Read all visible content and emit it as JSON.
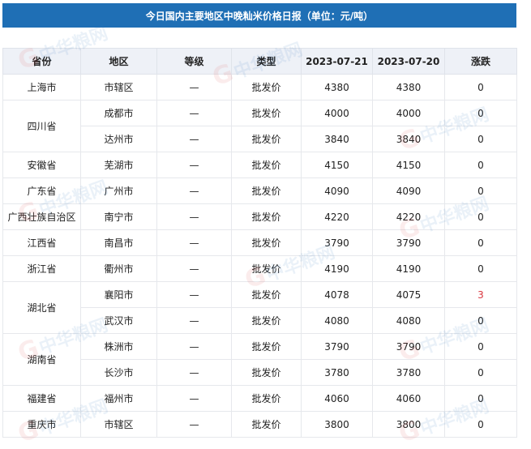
{
  "title": "今日国内主要地区中晚籼米价格日报（单位：元/吨）",
  "headers": [
    "省份",
    "地区",
    "等级",
    "类型",
    "2023-07-21",
    "2023-07-20",
    "涨跌"
  ],
  "grade_dash": "—",
  "type_label": "批发价",
  "watermark": "中华粮网",
  "rows": [
    {
      "province": "上海市",
      "span": 1,
      "city": "市辖区",
      "p1": "4380",
      "p2": "4380",
      "chg": "0"
    },
    {
      "province": "四川省",
      "span": 2,
      "city": "成都市",
      "p1": "4000",
      "p2": "4000",
      "chg": "0"
    },
    {
      "province": "",
      "span": 0,
      "city": "达州市",
      "p1": "3840",
      "p2": "3840",
      "chg": "0"
    },
    {
      "province": "安徽省",
      "span": 1,
      "city": "芜湖市",
      "p1": "4150",
      "p2": "4150",
      "chg": "0"
    },
    {
      "province": "广东省",
      "span": 1,
      "city": "广州市",
      "p1": "4090",
      "p2": "4090",
      "chg": "0"
    },
    {
      "province": "广西壮族自治区",
      "span": 1,
      "city": "南宁市",
      "p1": "4220",
      "p2": "4220",
      "chg": "0"
    },
    {
      "province": "江西省",
      "span": 1,
      "city": "南昌市",
      "p1": "3790",
      "p2": "3790",
      "chg": "0"
    },
    {
      "province": "浙江省",
      "span": 1,
      "city": "衢州市",
      "p1": "4190",
      "p2": "4190",
      "chg": "0"
    },
    {
      "province": "湖北省",
      "span": 2,
      "city": "襄阳市",
      "p1": "4078",
      "p2": "4075",
      "chg": "3"
    },
    {
      "province": "",
      "span": 0,
      "city": "武汉市",
      "p1": "4080",
      "p2": "4080",
      "chg": "0"
    },
    {
      "province": "湖南省",
      "span": 2,
      "city": "株洲市",
      "p1": "3790",
      "p2": "3790",
      "chg": "0"
    },
    {
      "province": "",
      "span": 0,
      "city": "长沙市",
      "p1": "3780",
      "p2": "3780",
      "chg": "0"
    },
    {
      "province": "福建省",
      "span": 1,
      "city": "福州市",
      "p1": "4060",
      "p2": "4060",
      "chg": "0"
    },
    {
      "province": "重庆市",
      "span": 1,
      "city": "市辖区",
      "p1": "3800",
      "p2": "3800",
      "chg": "0"
    }
  ]
}
